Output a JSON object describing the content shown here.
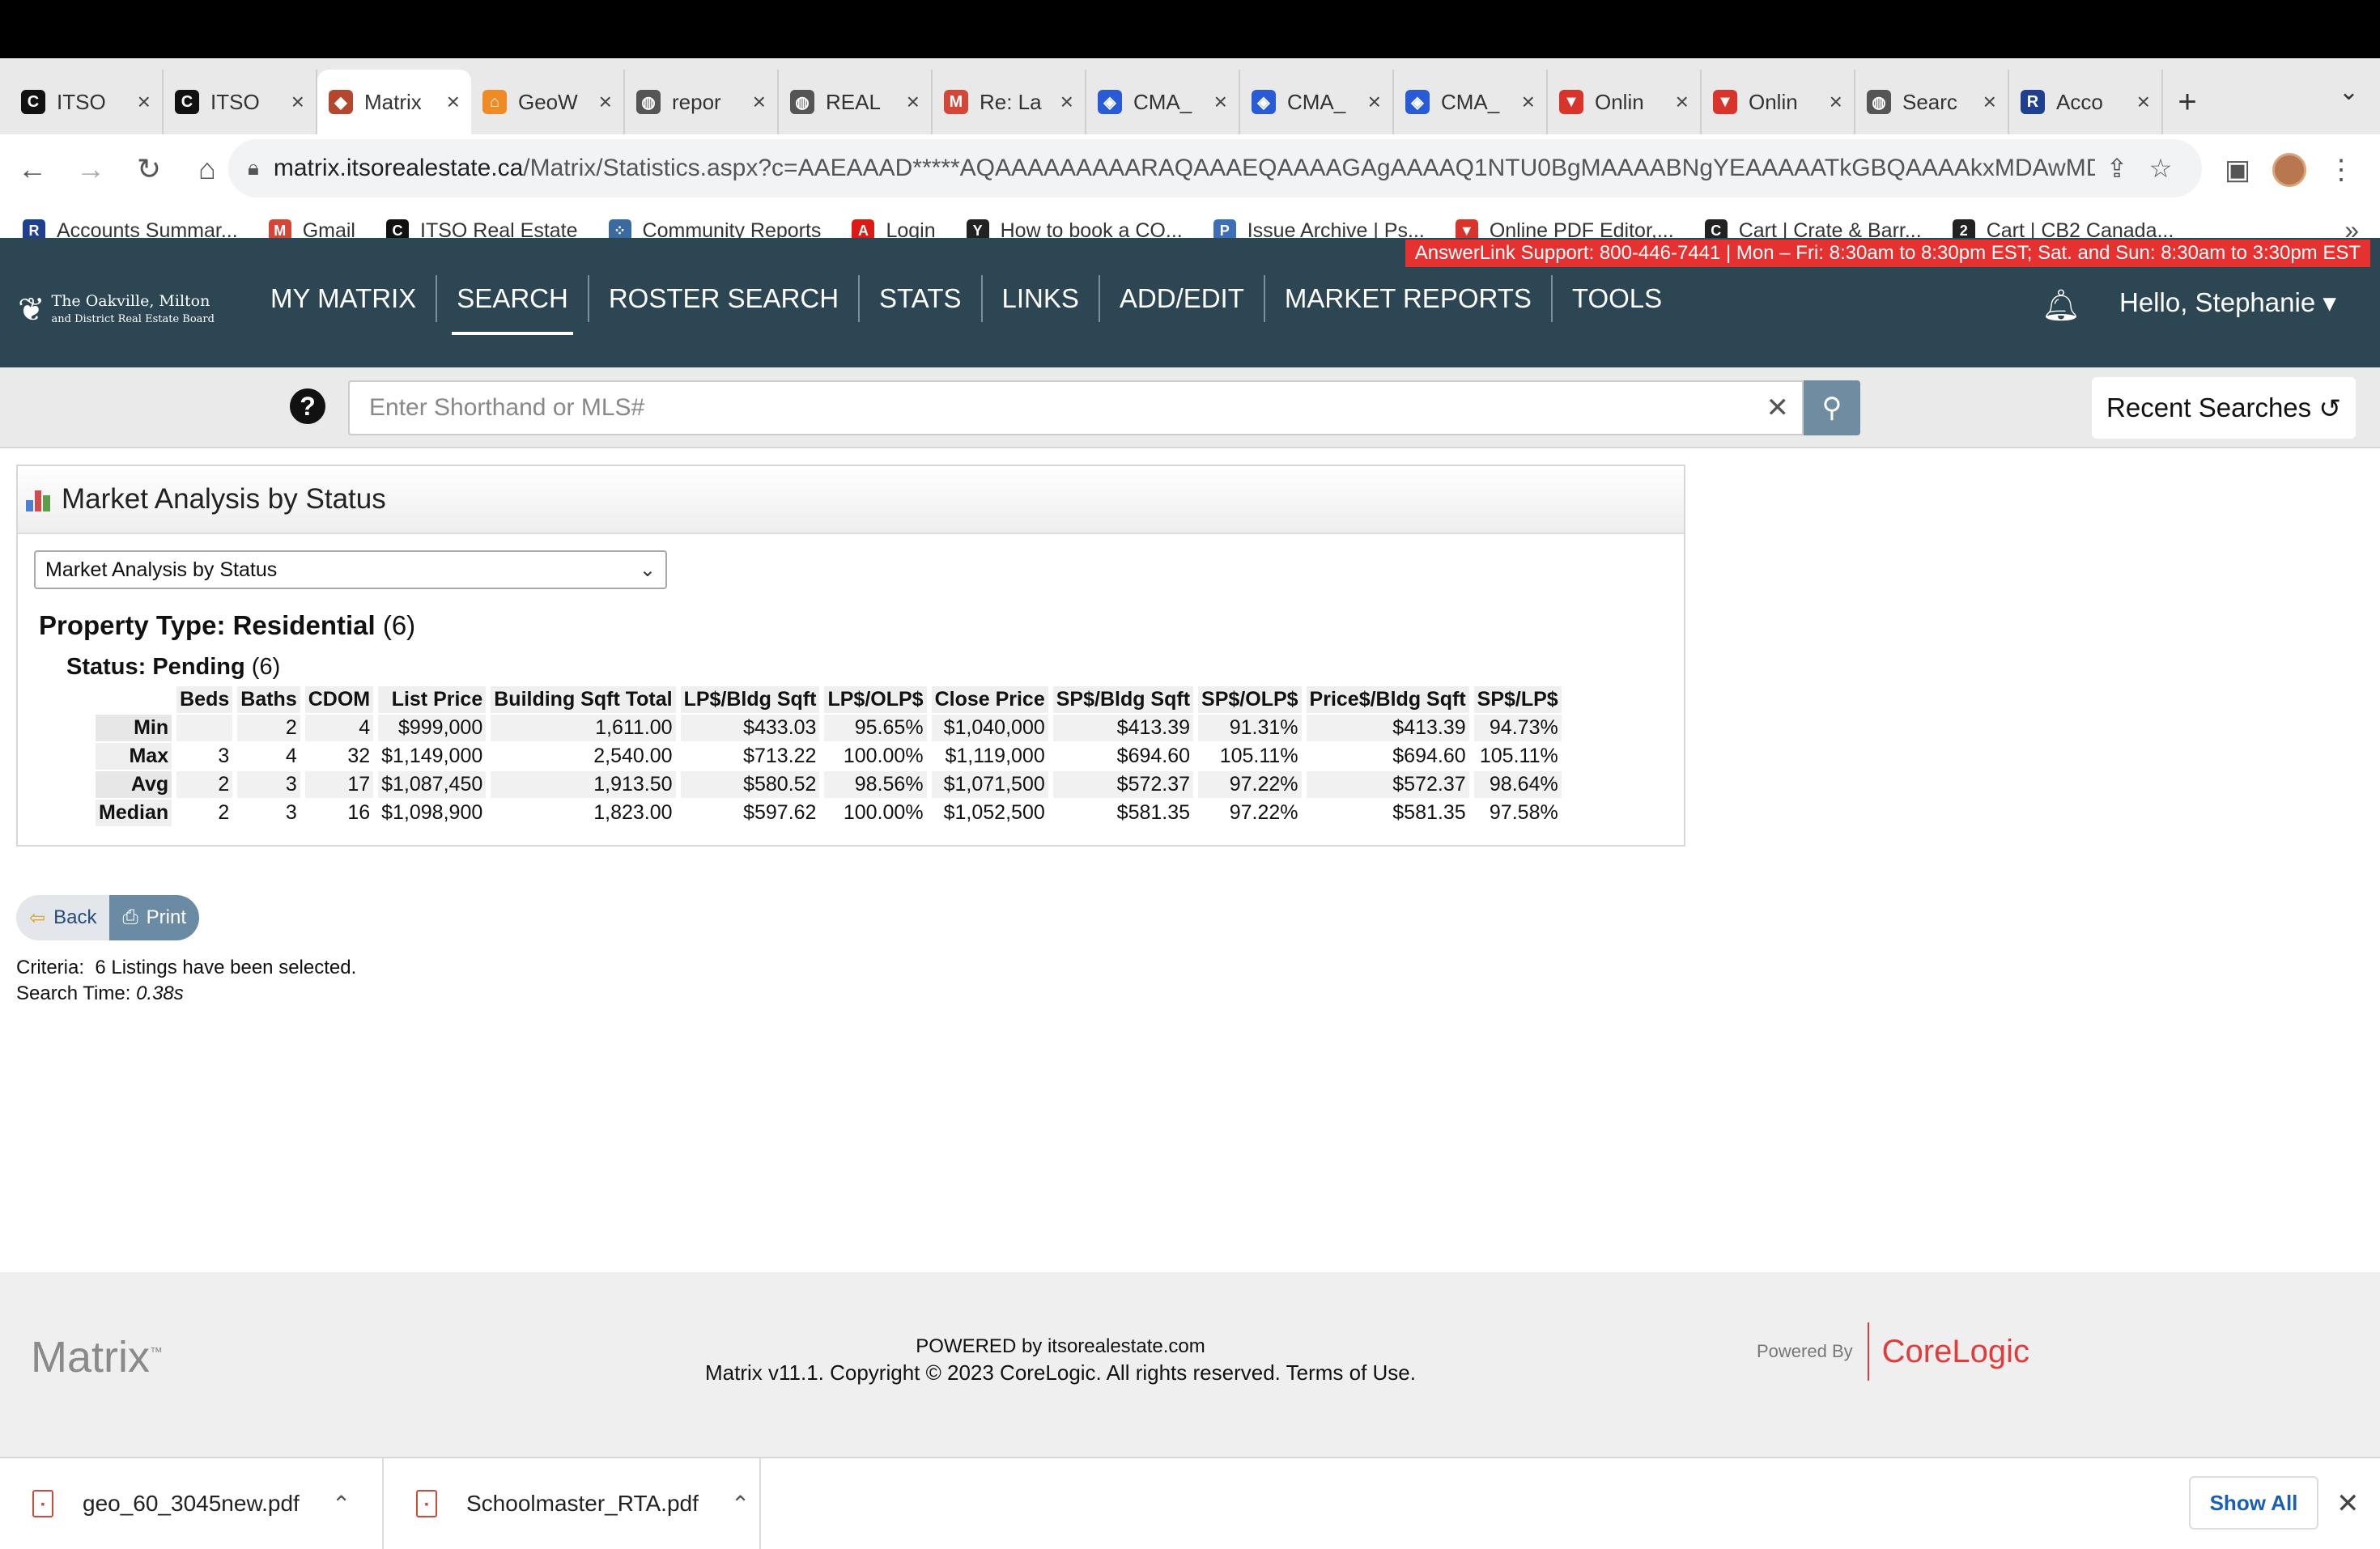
{
  "browser": {
    "tabs": [
      {
        "title": "ITSO",
        "icon": "corelogic-c-icon",
        "color": "#111111"
      },
      {
        "title": "ITSO",
        "icon": "corelogic-c-icon",
        "color": "#111111"
      },
      {
        "title": "Matrix",
        "icon": "matrix-cube-icon",
        "color": "#b5472f",
        "active": true
      },
      {
        "title": "GeoW",
        "icon": "house-icon",
        "color": "#f08a24"
      },
      {
        "title": "repor",
        "icon": "globe-icon",
        "color": "#555555"
      },
      {
        "title": "REAL",
        "icon": "globe-icon",
        "color": "#555555"
      },
      {
        "title": "Re: La",
        "icon": "gmail-icon",
        "color": "#d44638"
      },
      {
        "title": "CMA_",
        "icon": "dropbox-icon",
        "color": "#2a5bd7"
      },
      {
        "title": "CMA_",
        "icon": "dropbox-icon",
        "color": "#2a5bd7"
      },
      {
        "title": "CMA_",
        "icon": "dropbox-icon",
        "color": "#2a5bd7"
      },
      {
        "title": "Onlin",
        "icon": "pdf-editor-icon",
        "color": "#d9342b"
      },
      {
        "title": "Onlin",
        "icon": "pdf-editor-icon",
        "color": "#d9342b"
      },
      {
        "title": "Searc",
        "icon": "globe-icon",
        "color": "#555555"
      },
      {
        "title": "Acco",
        "icon": "rbc-icon",
        "color": "#1f3f8f"
      }
    ],
    "url_host": "matrix.itsorealestate.ca",
    "url_path": "/Matrix/Statistics.aspx?c=AAEAAAD*****AQAAAAAAAAARAQAAAEQAAAAGAgAAAAQ1NTU0BgMAAAABNgYEAAAAATkGBQAAAAkxMDAwMDU4...",
    "bookmarks": [
      {
        "label": "Accounts Summar...",
        "icon": "rbc-icon",
        "color": "#1f3f8f"
      },
      {
        "label": "Gmail",
        "icon": "gmail-icon",
        "color": "#d44638"
      },
      {
        "label": "ITSO Real Estate",
        "icon": "corelogic-c-icon",
        "color": "#111111"
      },
      {
        "label": "Community Reports",
        "icon": "grid-dots-icon",
        "color": "#3b6aa0"
      },
      {
        "label": "Login",
        "icon": "angular-icon",
        "color": "#dd1b16"
      },
      {
        "label": "How to book a CO...",
        "icon": "yelp-icon",
        "color": "#222222"
      },
      {
        "label": "Issue Archive | Ps...",
        "icon": "pt-icon",
        "color": "#3d6fb6"
      },
      {
        "label": "Online PDF Editor,...",
        "icon": "pdf-editor-icon",
        "color": "#d9342b"
      },
      {
        "label": "Cart | Crate & Barr...",
        "icon": "crate-c-icon",
        "color": "#222222"
      },
      {
        "label": "Cart | CB2 Canada...",
        "icon": "cb2-icon",
        "color": "#222222"
      }
    ]
  },
  "header": {
    "support_text": "AnswerLink Support: 800-446-7441 | Mon – Fri: 8:30am to 8:30pm EST; Sat. and Sun: 8:30am to 3:30pm EST",
    "logo_line1": "The Oakville, Milton",
    "logo_line2": "and District Real Estate Board",
    "nav": [
      "MY MATRIX",
      "SEARCH",
      "ROSTER SEARCH",
      "STATS",
      "LINKS",
      "ADD/EDIT",
      "MARKET REPORTS",
      "TOOLS"
    ],
    "active_nav": "SEARCH",
    "greeting": "Hello, Stephanie",
    "accent_color": "#2c4654",
    "support_color": "#e63131"
  },
  "search": {
    "placeholder": "Enter Shorthand or MLS#",
    "recent_label": "Recent Searches"
  },
  "panel": {
    "title": "Market Analysis by Status",
    "select_value": "Market Analysis by Status",
    "property_type_label": "Property Type: Residential",
    "property_type_count": "(6)",
    "status_label": "Status: Pending",
    "status_count": "(6)",
    "columns": [
      "Beds",
      "Baths",
      "CDOM",
      "List Price",
      "Building Sqft Total",
      "LP$/Bldg Sqft",
      "LP$/OLP$",
      "Close Price",
      "SP$/Bldg Sqft",
      "SP$/OLP$",
      "Price$/Bldg Sqft",
      "SP$/LP$"
    ],
    "rows": [
      {
        "label": "Min",
        "cells": [
          "",
          "2",
          "4",
          "$999,000",
          "1,611.00",
          "$433.03",
          "95.65%",
          "$1,040,000",
          "$413.39",
          "91.31%",
          "$413.39",
          "94.73%"
        ]
      },
      {
        "label": "Max",
        "cells": [
          "3",
          "4",
          "32",
          "$1,149,000",
          "2,540.00",
          "$713.22",
          "100.00%",
          "$1,119,000",
          "$694.60",
          "105.11%",
          "$694.60",
          "105.11%"
        ]
      },
      {
        "label": "Avg",
        "cells": [
          "2",
          "3",
          "17",
          "$1,087,450",
          "1,913.50",
          "$580.52",
          "98.56%",
          "$1,071,500",
          "$572.37",
          "97.22%",
          "$572.37",
          "98.64%"
        ]
      },
      {
        "label": "Median",
        "cells": [
          "2",
          "3",
          "16",
          "$1,098,900",
          "1,823.00",
          "$597.62",
          "100.00%",
          "$1,052,500",
          "$581.35",
          "97.22%",
          "$581.35",
          "97.58%"
        ]
      }
    ]
  },
  "actions": {
    "back_label": "Back",
    "print_label": "Print",
    "criteria_prefix": "Criteria:",
    "criteria_text": "6 Listings have been selected.",
    "search_time_label": "Search Time:",
    "search_time_value": "0.38s"
  },
  "footer": {
    "matrix_logo": "Matrix",
    "trademark": "™",
    "powered_line": "POWERED by itsorealestate.com",
    "copyright_line": "Matrix v11.1. Copyright © 2023 CoreLogic. All rights reserved. Terms of Use.",
    "powered_by": "Powered By",
    "corelogic": "CoreLogic"
  },
  "downloads": {
    "files": [
      "geo_60_3045new.pdf",
      "Schoolmaster_RTA.pdf"
    ],
    "show_all": "Show All"
  }
}
